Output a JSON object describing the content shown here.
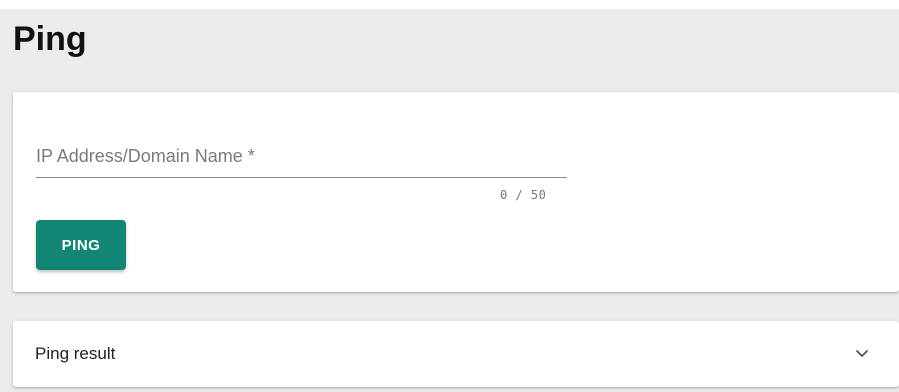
{
  "header": {
    "title": "Ping"
  },
  "form": {
    "field_label": "IP Address/Domain Name *",
    "field_value": "",
    "counter": "0 / 50",
    "ping_button_label": "PING"
  },
  "result_panel": {
    "label": "Ping result",
    "expand_icon": "chevron-down-icon",
    "expanded": false
  },
  "colors": {
    "background": "#ebebeb",
    "card": "#ffffff",
    "accent": "#138574",
    "text": "#111111",
    "muted": "#7a7a7a"
  }
}
